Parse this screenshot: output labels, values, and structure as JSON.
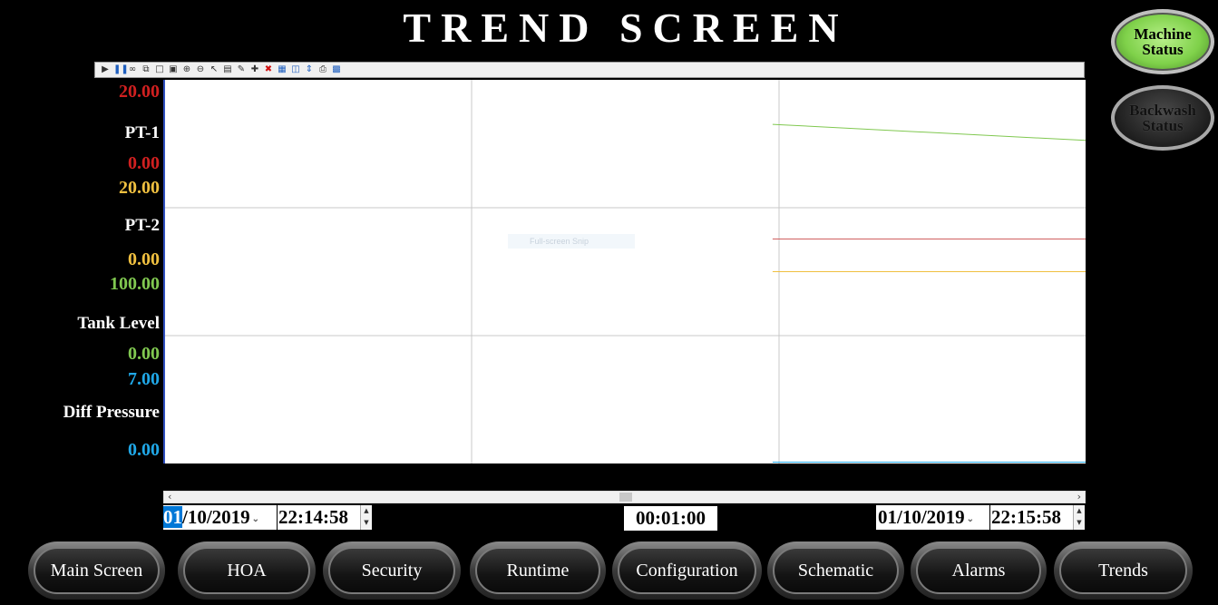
{
  "title": "TREND SCREEN",
  "status_buttons": {
    "machine": {
      "line1": "Machine",
      "line2": "Status"
    },
    "backwash": {
      "line1": "Backwash",
      "line2": "Status"
    }
  },
  "toolbar_icons": [
    "play-icon",
    "pause-icon",
    "link-icon",
    "copy-icon",
    "zoom-area-icon",
    "zoom-fit-icon",
    "zoom-in-icon",
    "zoom-out-icon",
    "cursor-icon",
    "table-icon",
    "edit-icon",
    "add-icon",
    "delete-icon",
    "layout-icon",
    "split-icon",
    "scale-icon",
    "print-icon",
    "export-icon"
  ],
  "axes": [
    {
      "name": "PT-1",
      "max": "20.00",
      "min": "0.00",
      "color": "#d02020"
    },
    {
      "name": "PT-2",
      "max": "20.00",
      "min": "0.00",
      "color": "#f0c040"
    },
    {
      "name": "Tank Level",
      "max": "100.00",
      "min": "0.00",
      "color": "#80c850"
    },
    {
      "name": "Diff Pressure",
      "max": "7.00",
      "min": "0.00",
      "color": "#20a8e8"
    }
  ],
  "chart_data": {
    "type": "line",
    "x_range": [
      "01/10/2019 22:14:58",
      "01/10/2019 22:15:58"
    ],
    "grid": true,
    "series": [
      {
        "name": "PT-1",
        "color": "#d06060",
        "ylim": [
          0,
          20
        ],
        "points": [
          [
            0.66,
            11.7
          ],
          [
            1.0,
            11.7
          ]
        ]
      },
      {
        "name": "PT-2",
        "color": "#f0c040",
        "ylim": [
          0,
          20
        ],
        "points": [
          [
            0.66,
            10.0
          ],
          [
            1.0,
            10.0
          ]
        ]
      },
      {
        "name": "Tank Level",
        "color": "#80c850",
        "ylim": [
          0,
          100
        ],
        "points": [
          [
            0.66,
            88.4
          ],
          [
            1.0,
            84.2
          ]
        ]
      },
      {
        "name": "Diff Pressure",
        "color": "#20a8e8",
        "ylim": [
          0,
          7
        ],
        "points": [
          [
            0.66,
            0.02
          ],
          [
            1.0,
            0.02
          ]
        ]
      }
    ]
  },
  "snip_overlay": "Full-screen Snip",
  "time_controls": {
    "start_date_sel": "01",
    "start_date_rest": "/10/2019",
    "start_time": "22:14:58",
    "duration": "00:01:00",
    "end_date": "01/10/2019",
    "end_time": "22:15:58"
  },
  "nav": [
    "Main Screen",
    "HOA",
    "Security",
    "Runtime",
    "Configuration",
    "Schematic",
    "Alarms",
    "Trends"
  ]
}
